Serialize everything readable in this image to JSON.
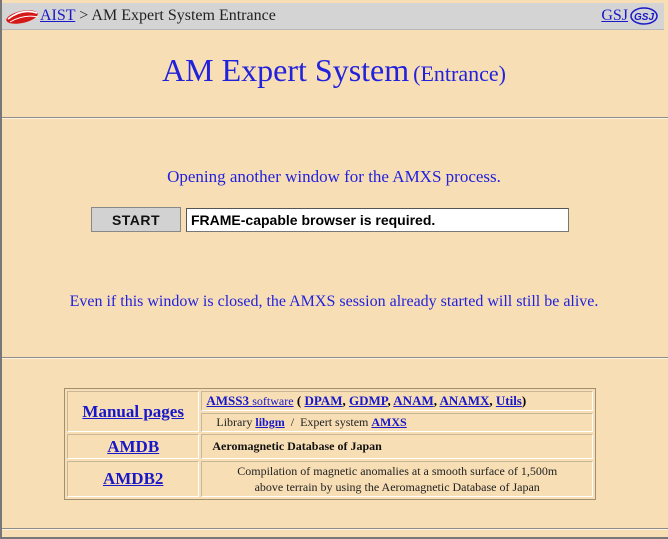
{
  "topbar": {
    "breadcrumb_link": "AIST",
    "breadcrumb_sep": " > ",
    "breadcrumb_current": "AM Expert System Entrance",
    "right_link": "GSJ",
    "left_logo_icon": "aist-logo-icon",
    "right_logo_icon": "gsj-logo-icon"
  },
  "title": {
    "main": "AM Expert System",
    "sub": "(Entrance)"
  },
  "opening_text": "Opening another window for the AMXS process.",
  "start_button": "START",
  "status_field": "FRAME-capable browser is required.",
  "alive_text": "Even if this window is closed, the AMXS session already started will still be alive.",
  "links_table": {
    "manual": {
      "header": "Manual pages",
      "row1": {
        "amss3": "AMSS3",
        "software": "software",
        "open_paren": " ( ",
        "items": [
          "DPAM",
          "GDMP",
          "ANAM",
          "ANAMX",
          "Utils"
        ],
        "close_paren": ")"
      },
      "row2": {
        "library_label": "Library ",
        "library_link": "libgm",
        "sep": "  /  ",
        "expert_label": "Expert system ",
        "expert_link": "AMXS"
      }
    },
    "amdb": {
      "header": "AMDB",
      "desc": "Aeromagnetic Database of Japan"
    },
    "amdb2": {
      "header": "AMDB2",
      "desc_line1": "Compilation of magnetic anomalies at a smooth surface of 1,500m",
      "desc_line2": "above terrain by using the Aeromagnetic Database of Japan"
    }
  },
  "colors": {
    "background": "#f7deb5",
    "topbar": "#d4d4d4",
    "link": "#1818c8",
    "heading_text": "#2222dd"
  }
}
